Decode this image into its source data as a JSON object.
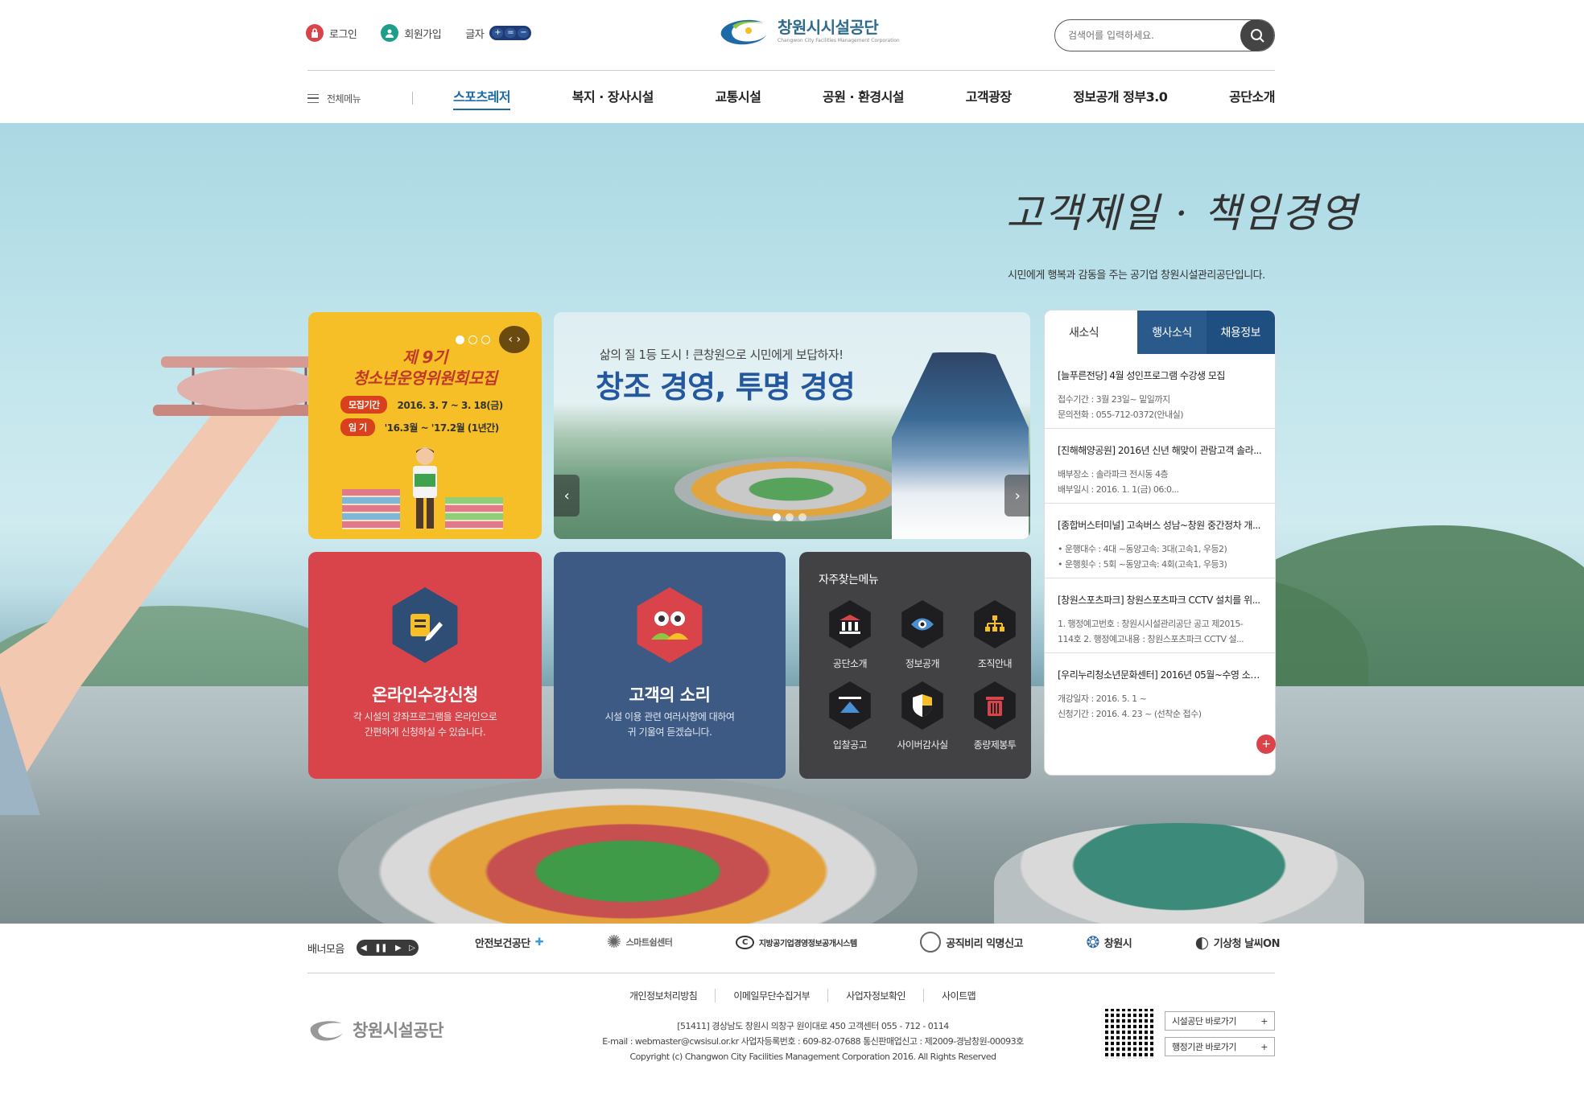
{
  "util": {
    "login": "로그인",
    "join": "회원가입",
    "font_label": "글자",
    "font_plus": "+",
    "font_reset": "=",
    "font_minus": "−"
  },
  "logo": {
    "title": "창원시시설공단",
    "subtitle": "Changwon City Facilities Management Corporation"
  },
  "search": {
    "placeholder": "검색어를 입력하세요."
  },
  "gnb": {
    "all_menu": "전체메뉴",
    "items": [
      "스포츠레저",
      "복지 · 장사시설",
      "교통시설",
      "공원 · 환경시설",
      "고객광장",
      "정보공개 정부3.0",
      "공단소개"
    ]
  },
  "hero": {
    "slogan": "고객제일 · 책임경영",
    "sub": "시민에게 행복과 감동을 주는 공기업  창원시설관리공단입니다."
  },
  "promo": {
    "t1": "제 9기",
    "t2": "청소년운영위원회모집",
    "row1_label": "모집기간",
    "row1_value": "2016. 3. 7 ~ 3. 18(금)",
    "row2_label": "임    기",
    "row2_value": "'16.3월 ~ '17.2월 (1년간)"
  },
  "slide": {
    "sub": "삶의 질 1등 도시 ! 큰창원으로 시민에게 보답하자!",
    "main": "창조 경영, 투명 경영",
    "prev": "‹",
    "next": "›"
  },
  "online": {
    "title": "온라인수강신청",
    "desc1": "각 시설의 강좌프로그램을 온라인으로",
    "desc2": "간편하게 신청하실 수 있습니다."
  },
  "voice": {
    "title": "고객의 소리",
    "desc1": "시설 이용 관련 여러사항에 대하여",
    "desc2": "귀 기울여 듣겠습니다."
  },
  "quick": {
    "heading": "자주찾는메뉴",
    "items": [
      "공단소개",
      "정보공개",
      "조직안내",
      "입찰공고",
      "사이버감사실",
      "종량제봉투"
    ]
  },
  "news": {
    "tabs": [
      "새소식",
      "행사소식",
      "채용정보"
    ],
    "items": [
      {
        "title": "[늘푸른전당] 4월 성인프로그램 수강생 모집",
        "d1": "접수기간 : 3월 23일~ 밑일까지",
        "d2": "문의전화 : 055-712-0372(안내실)"
      },
      {
        "title": "[진해해양공원] 2016년 신년 해맞이 관람고객 솔라...",
        "d1": "배부장소 : 솔라파크 전시동 4층",
        "d2": "배부일시 : 2016. 1. 1(금) 06:0..."
      },
      {
        "title": "[종합버스터미널] 고속버스 성남~창원 중간정차 개...",
        "d1": "• 운행대수 : 4대 ~동양고속: 3대(고속1, 우등2)",
        "d2": "• 운행횟수 : 5회 ~동양고속: 4회(고속1, 우등3)"
      },
      {
        "title": "[창원스포츠파크] 창원스포츠파크 CCTV 설치를 위...",
        "d1": "1. 행정예고번호 : 창원시시설관리공단 공고 제2015-",
        "d2": "114호 2. 행정예고내용 : 창원스포츠파크 CCTV 설..."
      },
      {
        "title": "[우리누리청소년문화센터] 2016년 05월~수영 소그...",
        "d1": "개강일자 : 2016. 5. 1 ~",
        "d2": "신청기간 : 2016. 4. 23 ~ (선착순 접수)"
      }
    ],
    "more": "+"
  },
  "banner": {
    "label": "배너모음",
    "logos": [
      "안전보건공단",
      "스마트쉼센터",
      "지방공기업경영정보공개시스템",
      "공직비리 익명신고",
      "창원시",
      "기상청 날씨ON"
    ]
  },
  "footer": {
    "links": [
      "개인정보처리방침",
      "이메일무단수집거부",
      "사업자정보확인",
      "사이트맵"
    ],
    "logo": "창원시설공단",
    "addr1": "[51411]  경상남도 창원시 의창구 원이대로 450     고객센터  055 - 712 - 0114",
    "addr2": "E-mail : webmaster@cwsisul.or.kr   사업자등록번호 : 609-82-07688    통신판매업신고 : 제2009-경남창원-00093호",
    "addr3": "Copyright (c) Changwon City Facilities Management Corporation 2016. All Rights Reserved",
    "sel1": "시설공단 바로가기",
    "sel2": "행정기관 바로가기",
    "sel_plus": "+"
  },
  "colors": {
    "accent": "#1d6aa8",
    "red": "#d9444a",
    "navy": "#3c5a84",
    "yellow": "#f6be27",
    "dark": "#424244"
  }
}
